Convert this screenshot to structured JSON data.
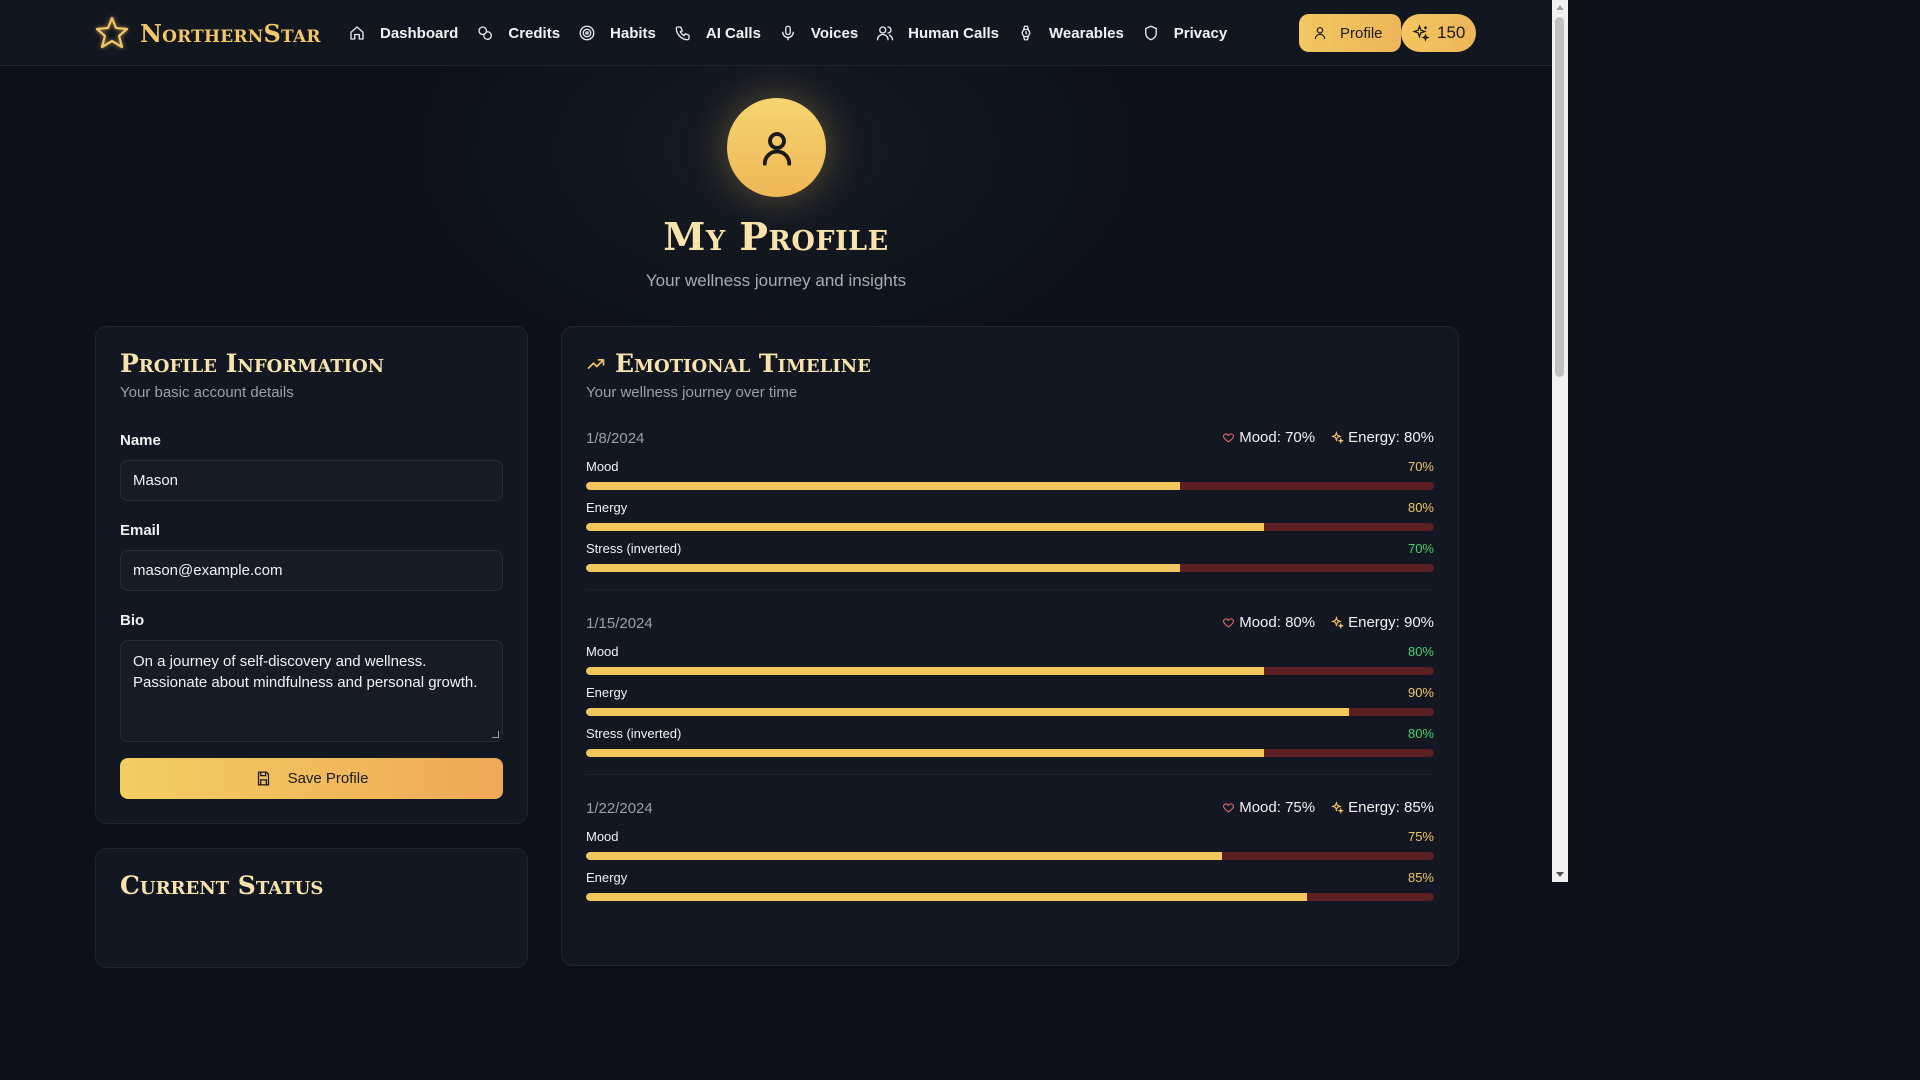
{
  "brand": {
    "name": "NorthernStar"
  },
  "nav": {
    "items": [
      {
        "label": "Dashboard",
        "icon": "home-icon"
      },
      {
        "label": "Credits",
        "icon": "coins-icon"
      },
      {
        "label": "Habits",
        "icon": "target-icon"
      },
      {
        "label": "AI Calls",
        "icon": "phone-icon"
      },
      {
        "label": "Voices",
        "icon": "mic-icon"
      },
      {
        "label": "Human Calls",
        "icon": "users-icon"
      },
      {
        "label": "Wearables",
        "icon": "watch-icon"
      },
      {
        "label": "Privacy",
        "icon": "shield-icon"
      }
    ],
    "profile_label": "Profile",
    "credits": "150"
  },
  "hero": {
    "title": "My Profile",
    "subtitle": "Your wellness journey and insights"
  },
  "profile_card": {
    "title": "Profile Information",
    "subtitle": "Your basic account details",
    "name_label": "Name",
    "name_value": "Mason",
    "email_label": "Email",
    "email_value": "mason@example.com",
    "bio_label": "Bio",
    "bio_value": "On a journey of self-discovery and wellness. Passionate about mindfulness and personal growth.",
    "save_label": "Save Profile"
  },
  "status_card": {
    "title": "Current Status"
  },
  "timeline": {
    "title": "Emotional Timeline",
    "subtitle": "Your wellness journey over time",
    "entries": [
      {
        "date": "1/8/2024",
        "mood_summary": "Mood: 70%",
        "energy_summary": "Energy: 80%",
        "metrics": [
          {
            "label": "Mood",
            "value": 70,
            "pct": "70%",
            "color": "gold"
          },
          {
            "label": "Energy",
            "value": 80,
            "pct": "80%",
            "color": "gold"
          },
          {
            "label": "Stress (inverted)",
            "value": 70,
            "pct": "70%",
            "color": "green"
          }
        ]
      },
      {
        "date": "1/15/2024",
        "mood_summary": "Mood: 80%",
        "energy_summary": "Energy: 90%",
        "metrics": [
          {
            "label": "Mood",
            "value": 80,
            "pct": "80%",
            "color": "green"
          },
          {
            "label": "Energy",
            "value": 90,
            "pct": "90%",
            "color": "gold"
          },
          {
            "label": "Stress (inverted)",
            "value": 80,
            "pct": "80%",
            "color": "green"
          }
        ]
      },
      {
        "date": "1/22/2024",
        "mood_summary": "Mood: 75%",
        "energy_summary": "Energy: 85%",
        "metrics": [
          {
            "label": "Mood",
            "value": 75,
            "pct": "75%",
            "color": "gold"
          },
          {
            "label": "Energy",
            "value": 85,
            "pct": "85%",
            "color": "gold"
          }
        ]
      }
    ]
  },
  "colors": {
    "accent": "#f3c667",
    "bar_track": "#5b1f23",
    "positive": "#46d36b",
    "background": "#0d1117"
  }
}
